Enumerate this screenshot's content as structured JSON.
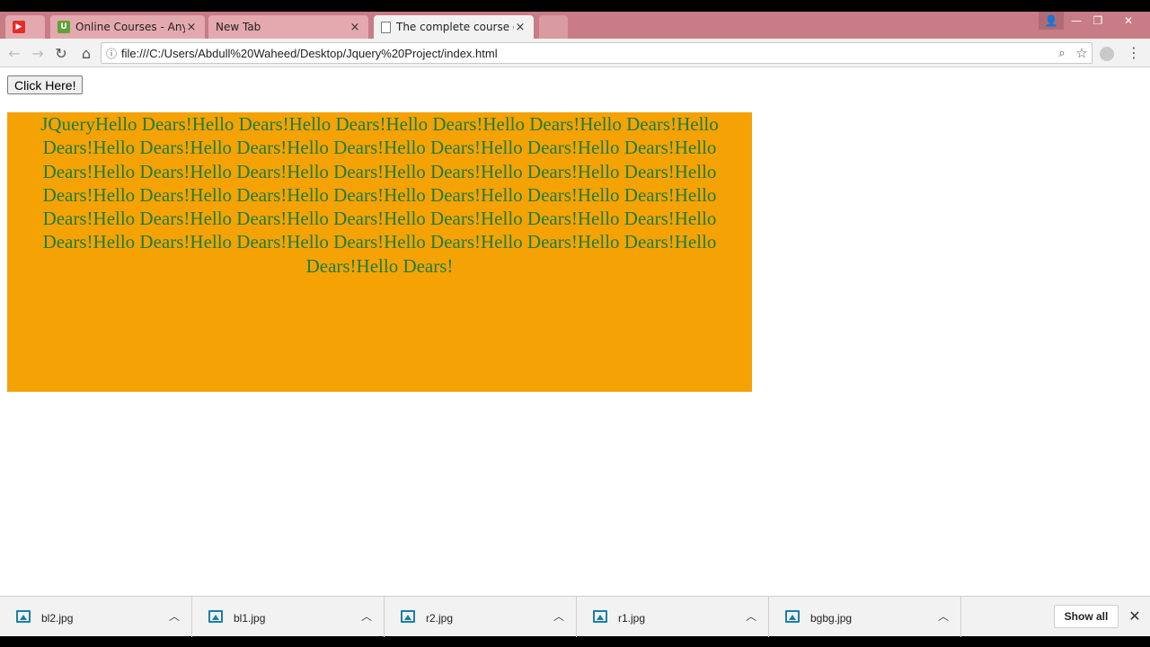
{
  "browser": {
    "tabs": [
      {
        "label": "",
        "favicon": "youtube-icon"
      },
      {
        "label": "Online Courses - Anytim",
        "favicon": "udemy-icon"
      },
      {
        "label": "New Tab",
        "favicon": ""
      },
      {
        "label": "The complete course of J",
        "favicon": "page-icon"
      }
    ],
    "url": "file:///C:/Users/Abdull%20Waheed/Desktop/Jquery%20Project/index.html"
  },
  "page": {
    "button_label": "Click Here!",
    "box_text": "JQueryHello Dears!Hello Dears!Hello Dears!Hello Dears!Hello Dears!Hello Dears!Hello Dears!Hello Dears!Hello Dears!Hello Dears!Hello Dears!Hello Dears!Hello Dears!Hello Dears!Hello Dears!Hello Dears!Hello Dears!Hello Dears!Hello Dears!Hello Dears!Hello Dears!Hello Dears!Hello Dears!Hello Dears!Hello Dears!Hello Dears!Hello Dears!Hello Dears!Hello Dears!Hello Dears!Hello Dears!Hello Dears!Hello Dears!Hello Dears!Hello Dears!Hello Dears!Hello Dears!Hello Dears!Hello Dears!Hello Dears!Hello Dears!Hello Dears!Hello Dears!",
    "box_color": "#f5a205",
    "text_color": "#1c7d3a"
  },
  "downloads": {
    "items": [
      {
        "name": "bl2.jpg"
      },
      {
        "name": "bl1.jpg"
      },
      {
        "name": "r2.jpg"
      },
      {
        "name": "r1.jpg"
      },
      {
        "name": "bgbg.jpg"
      }
    ],
    "show_all_label": "Show all"
  }
}
